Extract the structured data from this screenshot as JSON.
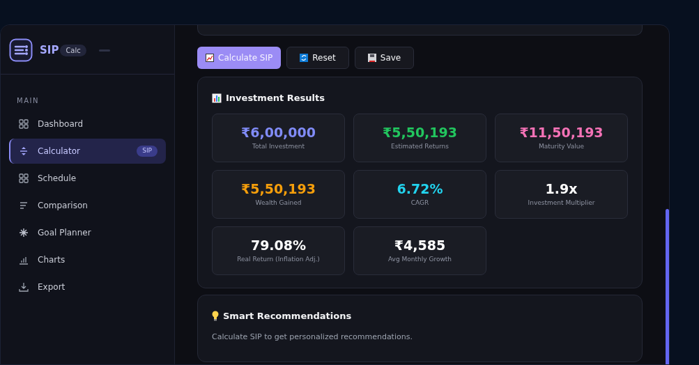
{
  "brand": {
    "name": "SIP",
    "badge": "Calc"
  },
  "sidebar": {
    "section": "MAIN",
    "items": [
      {
        "label": "Dashboard",
        "selected": false
      },
      {
        "label": "Calculator",
        "selected": true,
        "badge": "SIP"
      },
      {
        "label": "Schedule",
        "selected": false
      },
      {
        "label": "Comparison",
        "selected": false
      },
      {
        "label": "Goal Planner",
        "selected": false
      },
      {
        "label": "Charts",
        "selected": false
      },
      {
        "label": "Export",
        "selected": false
      }
    ]
  },
  "actions": [
    {
      "label": "Calculate SIP",
      "primary": true
    },
    {
      "label": "Reset",
      "primary": false
    },
    {
      "label": "Save",
      "primary": false
    }
  ],
  "results": {
    "title": "Investment Results",
    "metrics": [
      {
        "value": "₹6,00,000",
        "label": "Total Investment",
        "color": "#818cf8"
      },
      {
        "value": "₹5,50,193",
        "label": "Estimated Returns",
        "color": "#22c55e"
      },
      {
        "value": "₹11,50,193",
        "label": "Maturity Value",
        "color": "#f472b6"
      },
      {
        "value": "₹5,50,193",
        "label": "Wealth Gained",
        "color": "#f59e0b"
      },
      {
        "value": "6.72%",
        "label": "CAGR",
        "color": "#22d3ee"
      },
      {
        "value": "1.9x",
        "label": "Investment Multiplier",
        "color": "#ffffff"
      },
      {
        "value": "79.08%",
        "label": "Real Return (Inflation Adj.)",
        "color": "#ffffff"
      },
      {
        "value": "₹4,585",
        "label": "Avg Monthly Growth",
        "color": "#ffffff"
      }
    ]
  },
  "recommendations": {
    "title": "Smart Recommendations",
    "text": "Calculate SIP to get personalized recommendations."
  }
}
